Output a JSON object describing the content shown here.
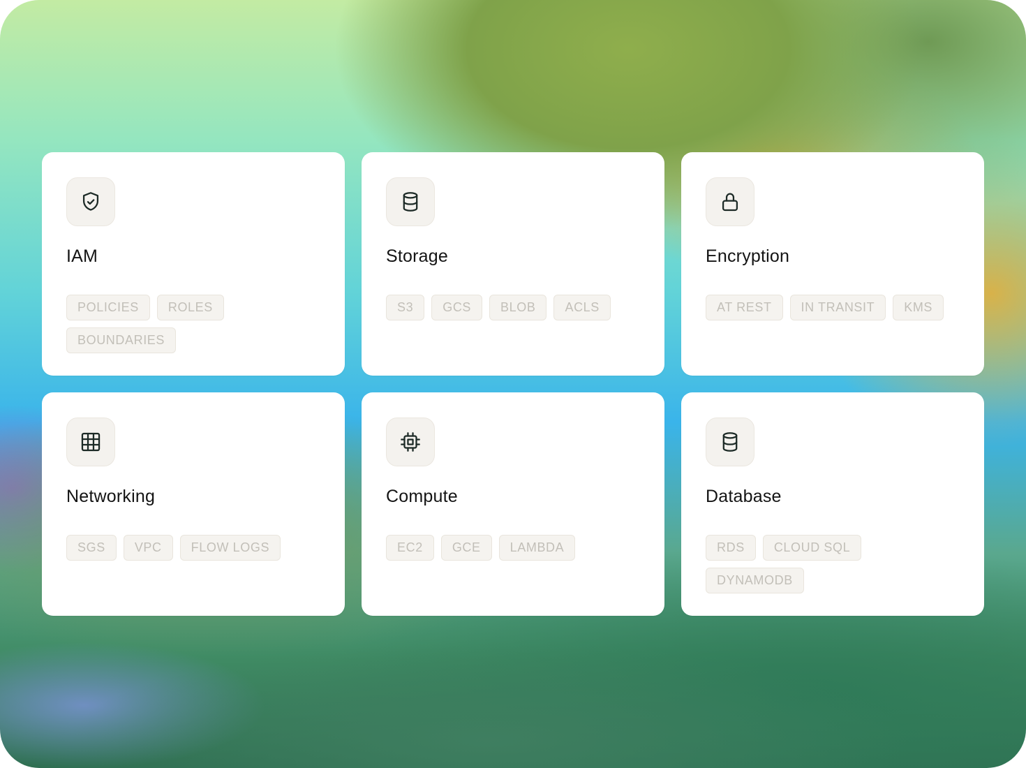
{
  "accent_color": "#141414",
  "cards": [
    {
      "title": "IAM",
      "icon": "shield-check-icon",
      "tags": [
        "POLICIES",
        "ROLES",
        "BOUNDARIES"
      ]
    },
    {
      "title": "Storage",
      "icon": "database-icon",
      "tags": [
        "S3",
        "GCS",
        "BLOB",
        "ACLS"
      ]
    },
    {
      "title": "Encryption",
      "icon": "lock-icon",
      "tags": [
        "AT REST",
        "IN TRANSIT",
        "KMS"
      ]
    },
    {
      "title": "Networking",
      "icon": "grid-icon",
      "tags": [
        "SGS",
        "VPC",
        "FLOW LOGS"
      ]
    },
    {
      "title": "Compute",
      "icon": "cpu-chip-icon",
      "tags": [
        "EC2",
        "GCE",
        "LAMBDA"
      ]
    },
    {
      "title": "Database",
      "icon": "database-icon",
      "tags": [
        "RDS",
        "CLOUD SQL",
        "DYNAMODB"
      ]
    }
  ]
}
